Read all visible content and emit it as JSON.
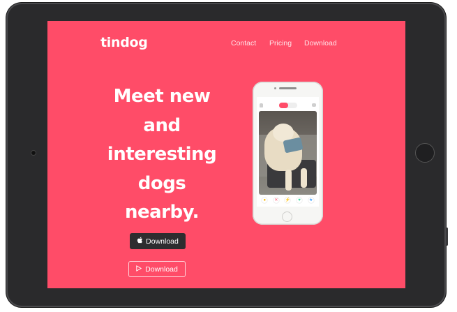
{
  "brand": {
    "name": "tindog"
  },
  "nav": {
    "items": [
      {
        "label": "Contact"
      },
      {
        "label": "Pricing"
      },
      {
        "label": "Download"
      }
    ]
  },
  "hero": {
    "headline_lines": [
      "Meet new",
      "and",
      "interesting",
      "dogs",
      "nearby."
    ],
    "download_apple_label": "Download",
    "download_google_label": "Download"
  },
  "phone": {
    "action_icons": [
      "rewind-icon",
      "nope-icon",
      "boost-icon",
      "like-icon",
      "superlike-icon"
    ]
  },
  "colors": {
    "accent": "#ff4c68",
    "dark_button": "#2d2d2f",
    "frame": "#2a2a2c"
  }
}
